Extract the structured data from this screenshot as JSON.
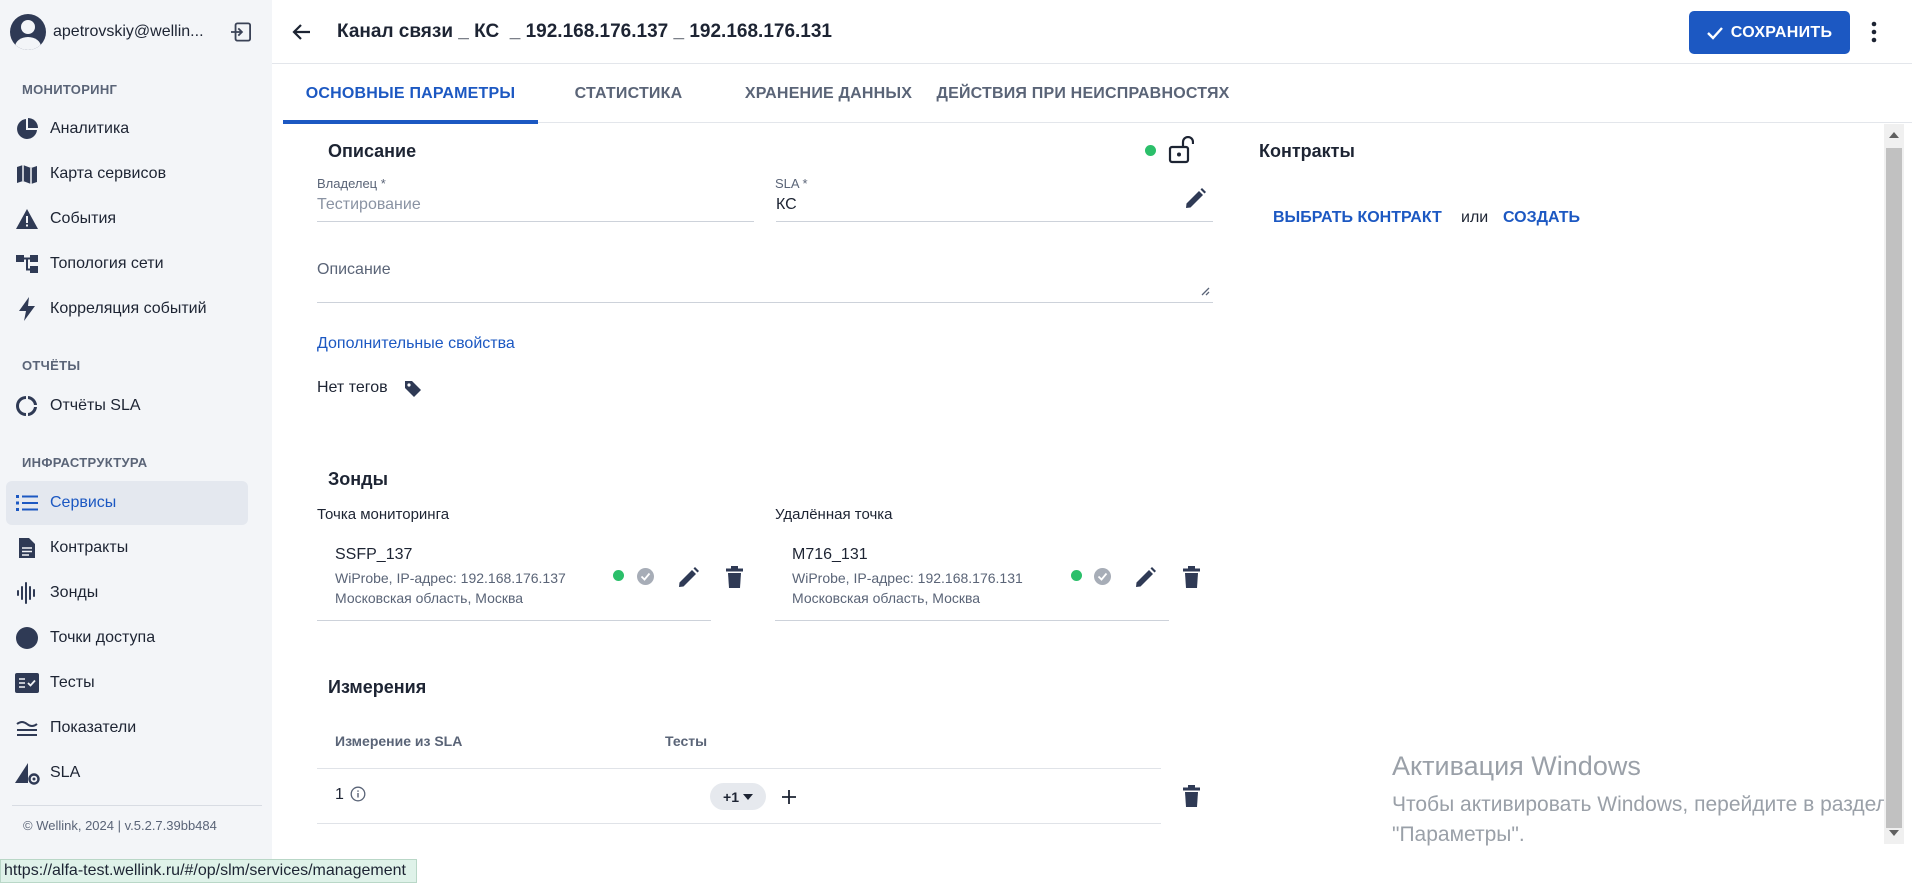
{
  "user": {
    "email": "apetrovskiy@wellin..."
  },
  "sidebar": {
    "sections": [
      {
        "title": "МОНИТОРИНГ",
        "items": [
          {
            "label": "Аналитика",
            "icon": "pie-chart-icon"
          },
          {
            "label": "Карта сервисов",
            "icon": "map-icon"
          },
          {
            "label": "События",
            "icon": "warning-icon"
          },
          {
            "label": "Топология сети",
            "icon": "topology-icon"
          },
          {
            "label": "Корреляция событий",
            "icon": "lightning-icon"
          }
        ]
      },
      {
        "title": "ОТЧЁТЫ",
        "items": [
          {
            "label": "Отчёты SLA",
            "icon": "donut-icon"
          }
        ]
      },
      {
        "title": "ИНФРАСТРУКТУРА",
        "items": [
          {
            "label": "Сервисы",
            "icon": "list-icon",
            "active": true
          },
          {
            "label": "Контракты",
            "icon": "document-icon"
          },
          {
            "label": "Зонды",
            "icon": "waveform-icon"
          },
          {
            "label": "Точки доступа",
            "icon": "circle-icon"
          },
          {
            "label": "Тесты",
            "icon": "checklist-icon"
          },
          {
            "label": "Показатели",
            "icon": "metrics-icon"
          },
          {
            "label": "SLA",
            "icon": "sla-icon"
          }
        ]
      }
    ],
    "version": "© Wellink, 2024 | v.5.2.7.39bb484"
  },
  "header": {
    "title": "Канал связи _ КС  _ 192.168.176.137 _ 192.168.176.131",
    "save_label": "СОХРАНИТЬ"
  },
  "tabs": [
    {
      "label": "ОСНОВНЫЕ ПАРАМЕТРЫ",
      "active": true
    },
    {
      "label": "СТАТИСТИКА"
    },
    {
      "label": "ХРАНЕНИЕ ДАННЫХ"
    },
    {
      "label": "ДЕЙСТВИЯ ПРИ НЕИСПРАВНОСТЯХ"
    }
  ],
  "description": {
    "heading": "Описание",
    "owner_label": "Владелец *",
    "owner_value": "Тестирование",
    "sla_label": "SLA *",
    "sla_value": "КС",
    "desc_placeholder": "Описание",
    "extra_link": "Дополнительные свойства",
    "no_tags": "Нет тегов"
  },
  "contracts": {
    "heading": "Контракты",
    "choose": "ВЫБРАТЬ КОНТРАКТ",
    "or": "или",
    "create": "СОЗДАТЬ"
  },
  "probes": {
    "heading": "Зонды",
    "monitoring": {
      "label": "Точка мониторинга",
      "name": "SSFP_137",
      "details": "WiProbe, IP-адрес: 192.168.176.137",
      "location": "Московская область, Москва"
    },
    "remote": {
      "label": "Удалённая точка",
      "name": "M716_131",
      "details": "WiProbe, IP-адрес: 192.168.176.131",
      "location": "Московская область, Москва"
    }
  },
  "measurements": {
    "heading": "Измерения",
    "col_measure": "Измерение из SLA",
    "col_tests": "Тесты",
    "rows": [
      {
        "value": "1",
        "tests_chip": "+1"
      }
    ]
  },
  "watermark": {
    "title": "Активация Windows",
    "text": "Чтобы активировать Windows, перейдите в раздел \"Параметры\"."
  },
  "status_url": "https://alfa-test.wellink.ru/#/op/slm/services/management",
  "colors": {
    "accent": "#1c58c2",
    "ok": "#2bbf6a",
    "text": "#1d2433",
    "muted": "#5a6477"
  }
}
